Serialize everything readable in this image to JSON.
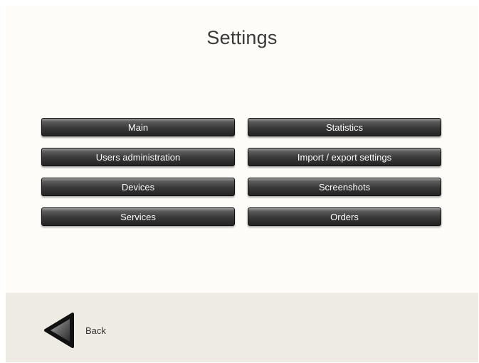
{
  "header": {
    "title": "Settings"
  },
  "menu": {
    "left": [
      {
        "label": "Main"
      },
      {
        "label": "Users administration"
      },
      {
        "label": "Devices"
      },
      {
        "label": "Services"
      }
    ],
    "right": [
      {
        "label": "Statistics"
      },
      {
        "label": "Import / export settings"
      },
      {
        "label": "Screenshots"
      },
      {
        "label": "Orders"
      }
    ]
  },
  "footer": {
    "back_label": "Back",
    "back_icon": "back-arrow-icon"
  },
  "colors": {
    "background": "#fdfcf8",
    "footer_background": "#edebe3",
    "button_top": "#9a9a9a",
    "button_bottom": "#242424",
    "button_text": "#ffffff",
    "title_text": "#3a3a3a"
  }
}
